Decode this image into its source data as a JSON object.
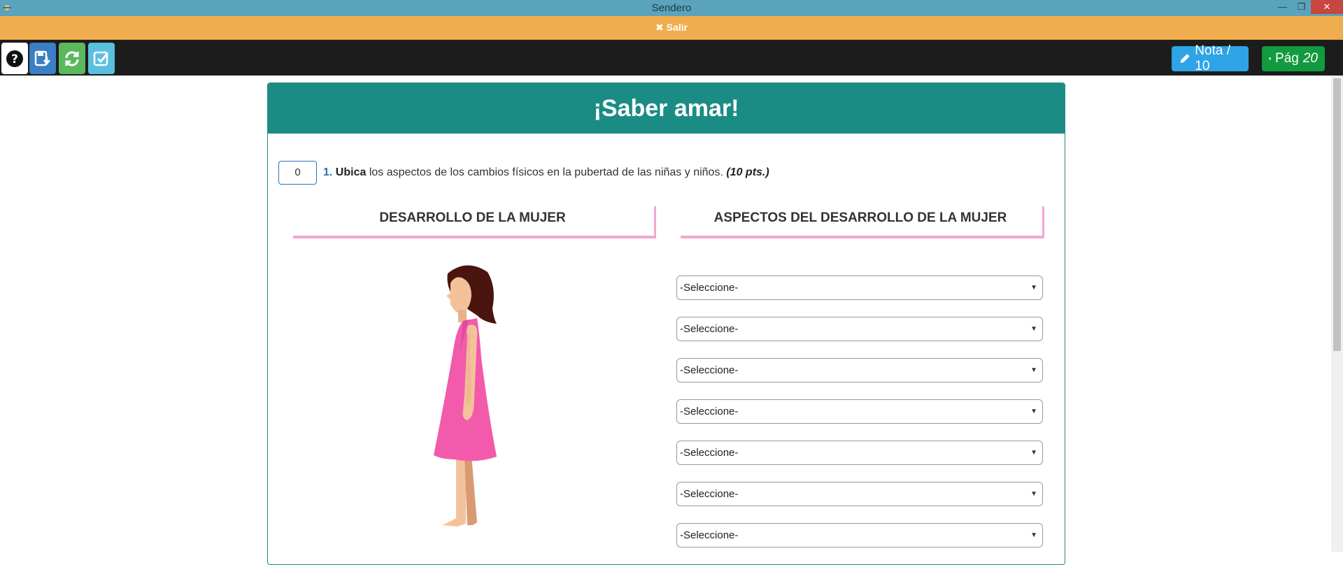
{
  "window": {
    "title": "Sendero"
  },
  "exitbar": {
    "label": "✖ Salir"
  },
  "toolbar": {
    "help_icon": "question-circle-icon",
    "save_icon": "save-download-icon",
    "refresh_icon": "refresh-icon",
    "check_icon": "check-square-icon",
    "nota_label": "Nota / 10",
    "pag_label": "Pág",
    "pag_number": "20"
  },
  "panel": {
    "title": "¡Saber amar!"
  },
  "question": {
    "score": "0",
    "number": "1.",
    "verb": "Ubica",
    "text": "los aspectos de los cambios físicos en la pubertad de las niñas y niños.",
    "points": "(10 pts.)"
  },
  "columns": {
    "left": "DESARROLLO DE LA MUJER",
    "right": "ASPECTOS DEL DESARROLLO DE LA MUJER"
  },
  "selects": [
    "-Seleccione-",
    "-Seleccione-",
    "-Seleccione-",
    "-Seleccione-",
    "-Seleccione-",
    "-Seleccione-",
    "-Seleccione-"
  ],
  "colors": {
    "teal": "#1b8c84",
    "orange": "#f0ad4e",
    "pink_shadow": "#f4a6cf",
    "dress": "#f35aab"
  }
}
